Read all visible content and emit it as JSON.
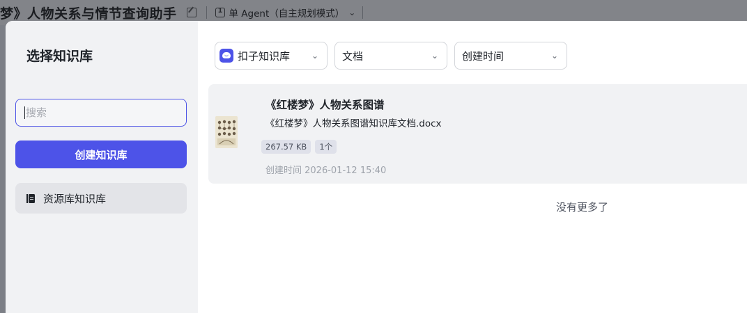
{
  "topbar": {
    "title": "梦》人物关系与情节查询助手",
    "mode_label": "单 Agent（自主规划模式）"
  },
  "sidebar": {
    "title": "选择知识库",
    "search_placeholder": "搜索",
    "create_button": "创建知识库",
    "items": [
      {
        "label": "资源库知识库"
      }
    ]
  },
  "filters": {
    "source": "扣子知识库",
    "type": "文档",
    "sort": "创建时间"
  },
  "documents": [
    {
      "title": "《红楼梦》人物关系图谱",
      "filename": "《红楼梦》人物关系图谱知识库文档.docx",
      "size": "267.57 KB",
      "count": "1个",
      "created": "创建时间 2026-01-12 15:40"
    }
  ],
  "list_end": "没有更多了",
  "colors": {
    "accent": "#4d53e8",
    "sidebar_bg": "#f1f2f4",
    "overlay": "#7c7f86"
  },
  "icons": {
    "edit": "edit-icon",
    "mode": "agent-mode-icon",
    "chevron": "chevron-down-icon",
    "coze": "coze-logo-icon",
    "library": "library-icon"
  }
}
